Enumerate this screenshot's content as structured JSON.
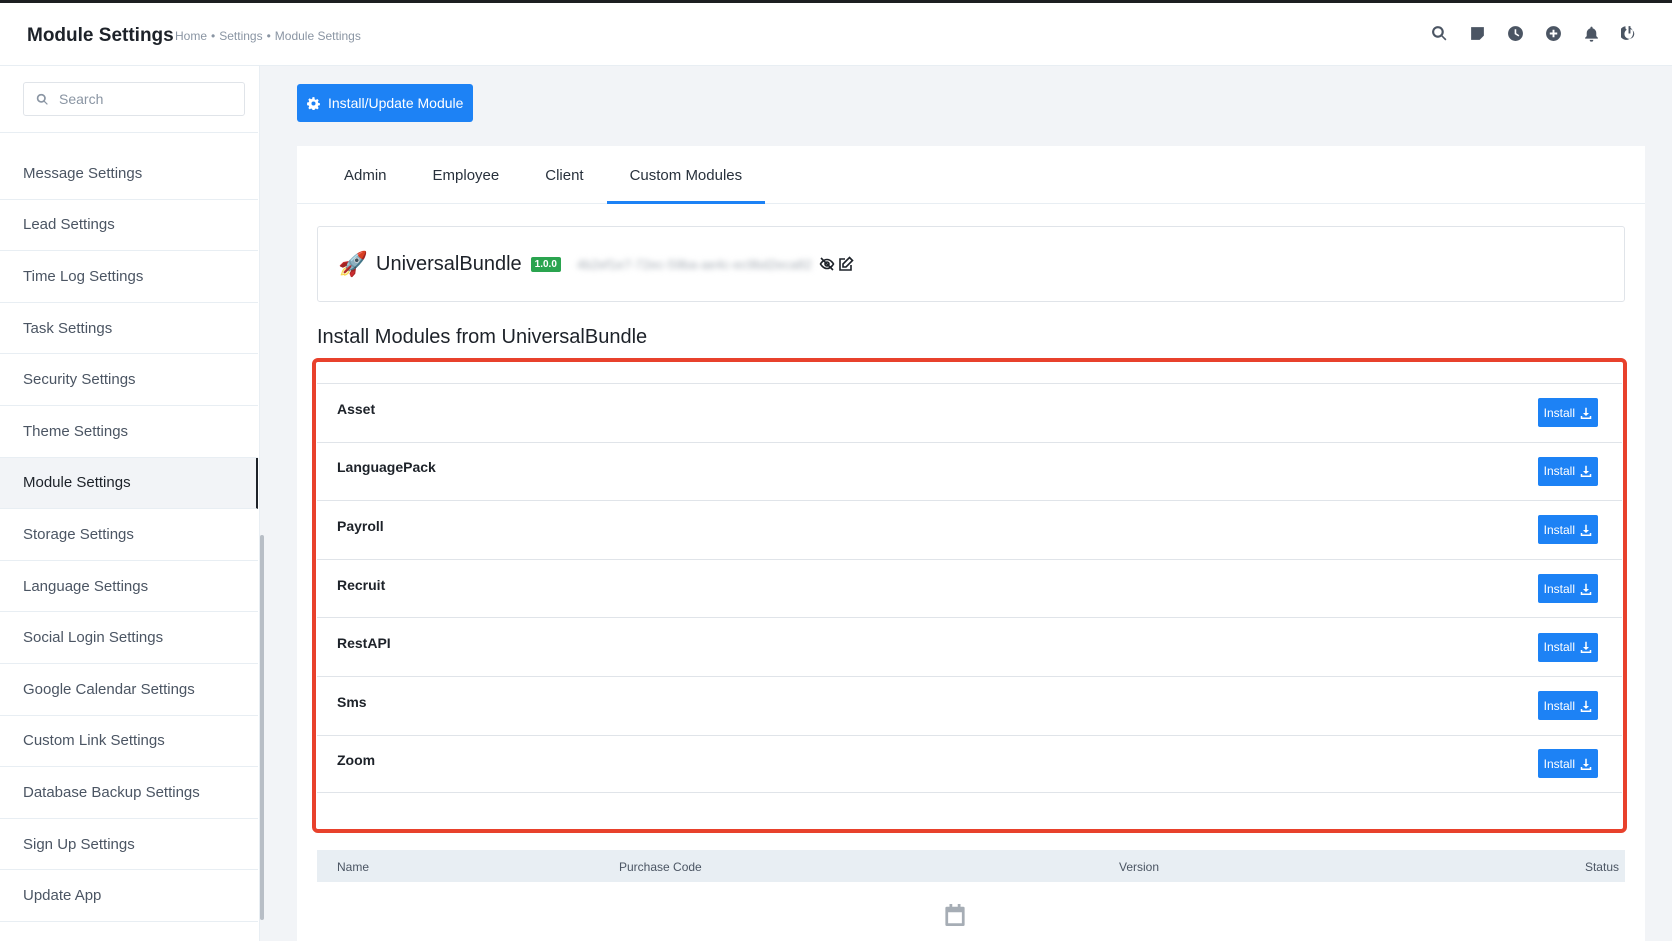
{
  "header": {
    "title": "Module Settings",
    "breadcrumb": [
      "Home",
      "Settings",
      "Module Settings"
    ],
    "icons": [
      "search-icon",
      "sticky-note-icon",
      "clock-icon",
      "plus-circle-icon",
      "bell-icon",
      "power-icon"
    ]
  },
  "sidebar": {
    "search_placeholder": "Search",
    "items": [
      {
        "label": "Message Settings"
      },
      {
        "label": "Lead Settings"
      },
      {
        "label": "Time Log Settings"
      },
      {
        "label": "Task Settings"
      },
      {
        "label": "Security Settings"
      },
      {
        "label": "Theme Settings"
      },
      {
        "label": "Module Settings",
        "active": true
      },
      {
        "label": "Storage Settings"
      },
      {
        "label": "Language Settings"
      },
      {
        "label": "Social Login Settings"
      },
      {
        "label": "Google Calendar Settings"
      },
      {
        "label": "Custom Link Settings"
      },
      {
        "label": "Database Backup Settings"
      },
      {
        "label": "Sign Up Settings"
      },
      {
        "label": "Update App"
      }
    ]
  },
  "main": {
    "install_update_label": "Install/Update Module",
    "tabs": [
      {
        "label": "Admin"
      },
      {
        "label": "Employee"
      },
      {
        "label": "Client"
      },
      {
        "label": "Custom Modules",
        "active": true
      }
    ],
    "bundle": {
      "name": "UniversalBundle",
      "version": "1.0.0",
      "purchase_code": "4b2ef1e7-72ec-59ba-ae4c-ec9bd2eca82"
    },
    "section_title": "Install Modules from UniversalBundle",
    "install_label": "Install",
    "modules": [
      {
        "name": "Asset"
      },
      {
        "name": "LanguagePack"
      },
      {
        "name": "Payroll"
      },
      {
        "name": "Recruit"
      },
      {
        "name": "RestAPI"
      },
      {
        "name": "Sms"
      },
      {
        "name": "Zoom"
      }
    ],
    "table_headers": {
      "name": "Name",
      "purchase_code": "Purchase Code",
      "version": "Version",
      "status": "Status"
    }
  },
  "colors": {
    "primary": "#1d82f5",
    "highlight": "#e8412c",
    "badge": "#2aa44f"
  }
}
